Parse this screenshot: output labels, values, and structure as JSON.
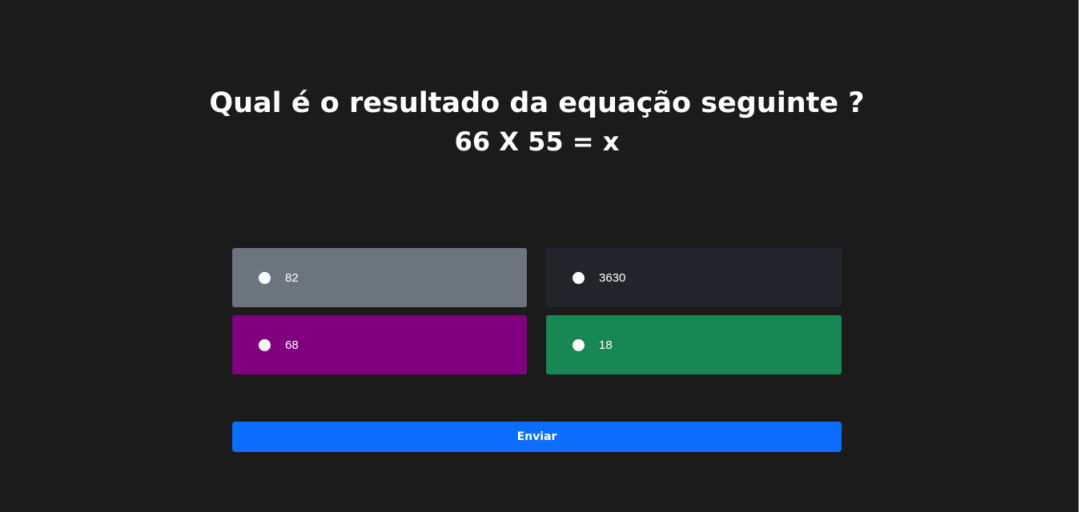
{
  "question": {
    "title": "Qual é o resultado da equação seguinte ?",
    "equation": "66 X 55 = x"
  },
  "options": [
    {
      "label": "82",
      "color": "#6c757d"
    },
    {
      "label": "3630",
      "color": "#212529"
    },
    {
      "label": "68",
      "color": "#800080"
    },
    {
      "label": "18",
      "color": "#198754"
    }
  ],
  "submit": {
    "label": "Enviar",
    "color": "#0d6efd"
  },
  "theme": {
    "background": "#1b1b1b"
  }
}
